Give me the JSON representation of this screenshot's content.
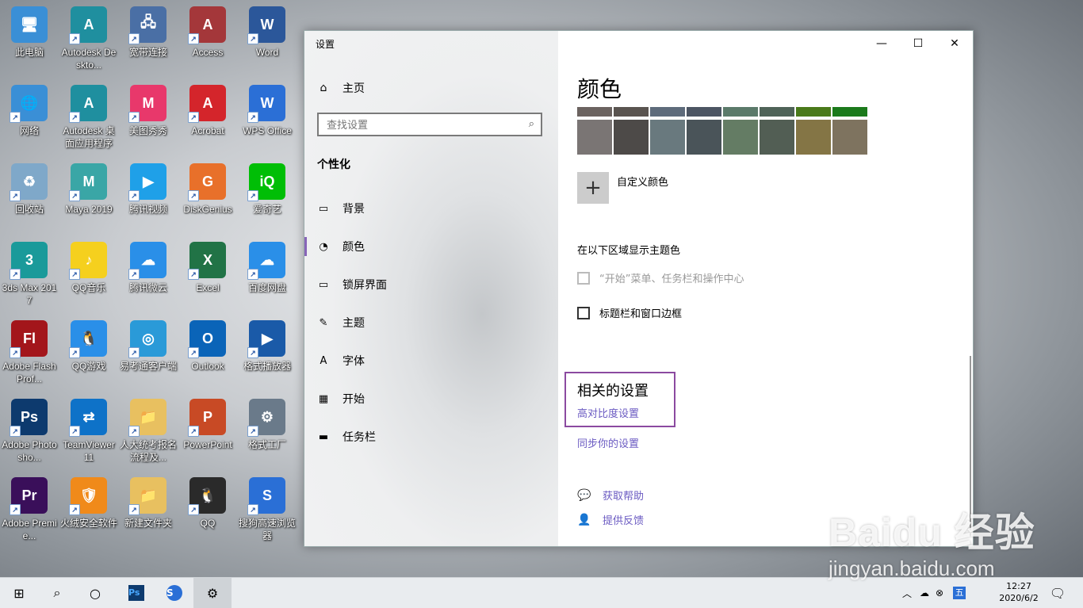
{
  "desktop": {
    "icons": [
      {
        "label": "此电脑",
        "color": "#3a8fd6",
        "glyph": "🖥"
      },
      {
        "label": "Autodesk Deskto...",
        "color": "#1f8f9f",
        "glyph": "A"
      },
      {
        "label": "宽带连接",
        "color": "#4a6fa5",
        "glyph": "🖧"
      },
      {
        "label": "Access",
        "color": "#a4373a",
        "glyph": "A"
      },
      {
        "label": "Word",
        "color": "#2b579a",
        "glyph": "W"
      },
      {
        "label": "网络",
        "color": "#3a8fd6",
        "glyph": "🌐"
      },
      {
        "label": "Autodesk 桌面应用程序",
        "color": "#1f8f9f",
        "glyph": "A"
      },
      {
        "label": "美图秀秀",
        "color": "#e8386b",
        "glyph": "M"
      },
      {
        "label": "Acrobat",
        "color": "#d4252b",
        "glyph": "A"
      },
      {
        "label": "WPS Office",
        "color": "#2b6fd6",
        "glyph": "W"
      },
      {
        "label": "回收站",
        "color": "#7fa8c9",
        "glyph": "♻"
      },
      {
        "label": "Maya 2019",
        "color": "#3aa6a6",
        "glyph": "M"
      },
      {
        "label": "腾讯视频",
        "color": "#1fa0e8",
        "glyph": "▶"
      },
      {
        "label": "DiskGenius",
        "color": "#e8702a",
        "glyph": "G"
      },
      {
        "label": "爱奇艺",
        "color": "#00be06",
        "glyph": "iQ"
      },
      {
        "label": "3ds Max 2017",
        "color": "#1a9a9a",
        "glyph": "3"
      },
      {
        "label": "QQ音乐",
        "color": "#f5d01e",
        "glyph": "♪"
      },
      {
        "label": "腾讯微云",
        "color": "#2a8fe8",
        "glyph": "☁"
      },
      {
        "label": "Excel",
        "color": "#217346",
        "glyph": "X"
      },
      {
        "label": "百度网盘",
        "color": "#2a8fe8",
        "glyph": "☁"
      },
      {
        "label": "Adobe Flash Prof...",
        "color": "#a3161b",
        "glyph": "Fl"
      },
      {
        "label": "QQ游戏",
        "color": "#2a8fe8",
        "glyph": "🐧"
      },
      {
        "label": "易考通客户端",
        "color": "#2a9ad8",
        "glyph": "◎"
      },
      {
        "label": "Outlook",
        "color": "#0a64b8",
        "glyph": "O"
      },
      {
        "label": "格式播放器",
        "color": "#1a5aa8",
        "glyph": "▶"
      },
      {
        "label": "Adobe Photosho...",
        "color": "#0d3a6e",
        "glyph": "Ps"
      },
      {
        "label": "TeamViewer 11",
        "color": "#0e72c8",
        "glyph": "⇄"
      },
      {
        "label": "人大统考报名流程及...",
        "color": "#e8c060",
        "glyph": "📁"
      },
      {
        "label": "PowerPoint",
        "color": "#c84a25",
        "glyph": "P"
      },
      {
        "label": "格式工厂",
        "color": "#6a7a8a",
        "glyph": "⚙"
      },
      {
        "label": "Adobe Premie...",
        "color": "#3a0f5a",
        "glyph": "Pr"
      },
      {
        "label": "火绒安全软件",
        "color": "#f08a1a",
        "glyph": "🛡"
      },
      {
        "label": "新建文件夹",
        "color": "#e8c060",
        "glyph": "📁"
      },
      {
        "label": "QQ",
        "color": "#2a2a2a",
        "glyph": "🐧"
      },
      {
        "label": "搜狗高速浏览器",
        "color": "#2a6fd6",
        "glyph": "S"
      }
    ]
  },
  "window": {
    "title": "设置",
    "minimize_icon": "minimize-icon",
    "maximize_icon": "maximize-icon",
    "close_icon": "close-icon"
  },
  "nav": {
    "home_label": "主页",
    "search_placeholder": "查找设置",
    "section": "个性化",
    "items": [
      {
        "label": "背景",
        "icon": "image-icon"
      },
      {
        "label": "颜色",
        "icon": "palette-icon"
      },
      {
        "label": "锁屏界面",
        "icon": "lockscreen-icon"
      },
      {
        "label": "主题",
        "icon": "theme-icon"
      },
      {
        "label": "字体",
        "icon": "font-icon"
      },
      {
        "label": "开始",
        "icon": "start-icon"
      },
      {
        "label": "任务栏",
        "icon": "taskbar-icon"
      }
    ],
    "active_index": 1
  },
  "content": {
    "heading": "颜色",
    "swatches_top": [
      "#6b6360",
      "#5a5450",
      "#5e6b7b",
      "#4c5563",
      "#5b7a6a",
      "#4f6358",
      "#4a7a1a",
      "#1b7a1b"
    ],
    "swatches_bottom": [
      "#7a7574",
      "#4d4a48",
      "#69797e",
      "#4a5459",
      "#647c64",
      "#525e54",
      "#847545",
      "#7e735f"
    ],
    "custom_color_label": "自定义颜色",
    "show_accent_heading": "在以下区域显示主题色",
    "checkbox_start": "“开始”菜单、任务栏和操作中心",
    "checkbox_titlebar": "标题栏和窗口边框",
    "related_heading": "相关的设置",
    "high_contrast": "高对比度设置",
    "sync": "同步你的设置",
    "get_help": "获取帮助",
    "feedback": "提供反馈",
    "accent_color": "#8764b8",
    "link_color": "#6b5bc2"
  },
  "taskbar": {
    "tray_ime": "五",
    "time": "12:27",
    "date": "2020/6/2"
  },
  "watermark": {
    "brand": "Baidu 经验",
    "url": "jingyan.baidu.com"
  }
}
